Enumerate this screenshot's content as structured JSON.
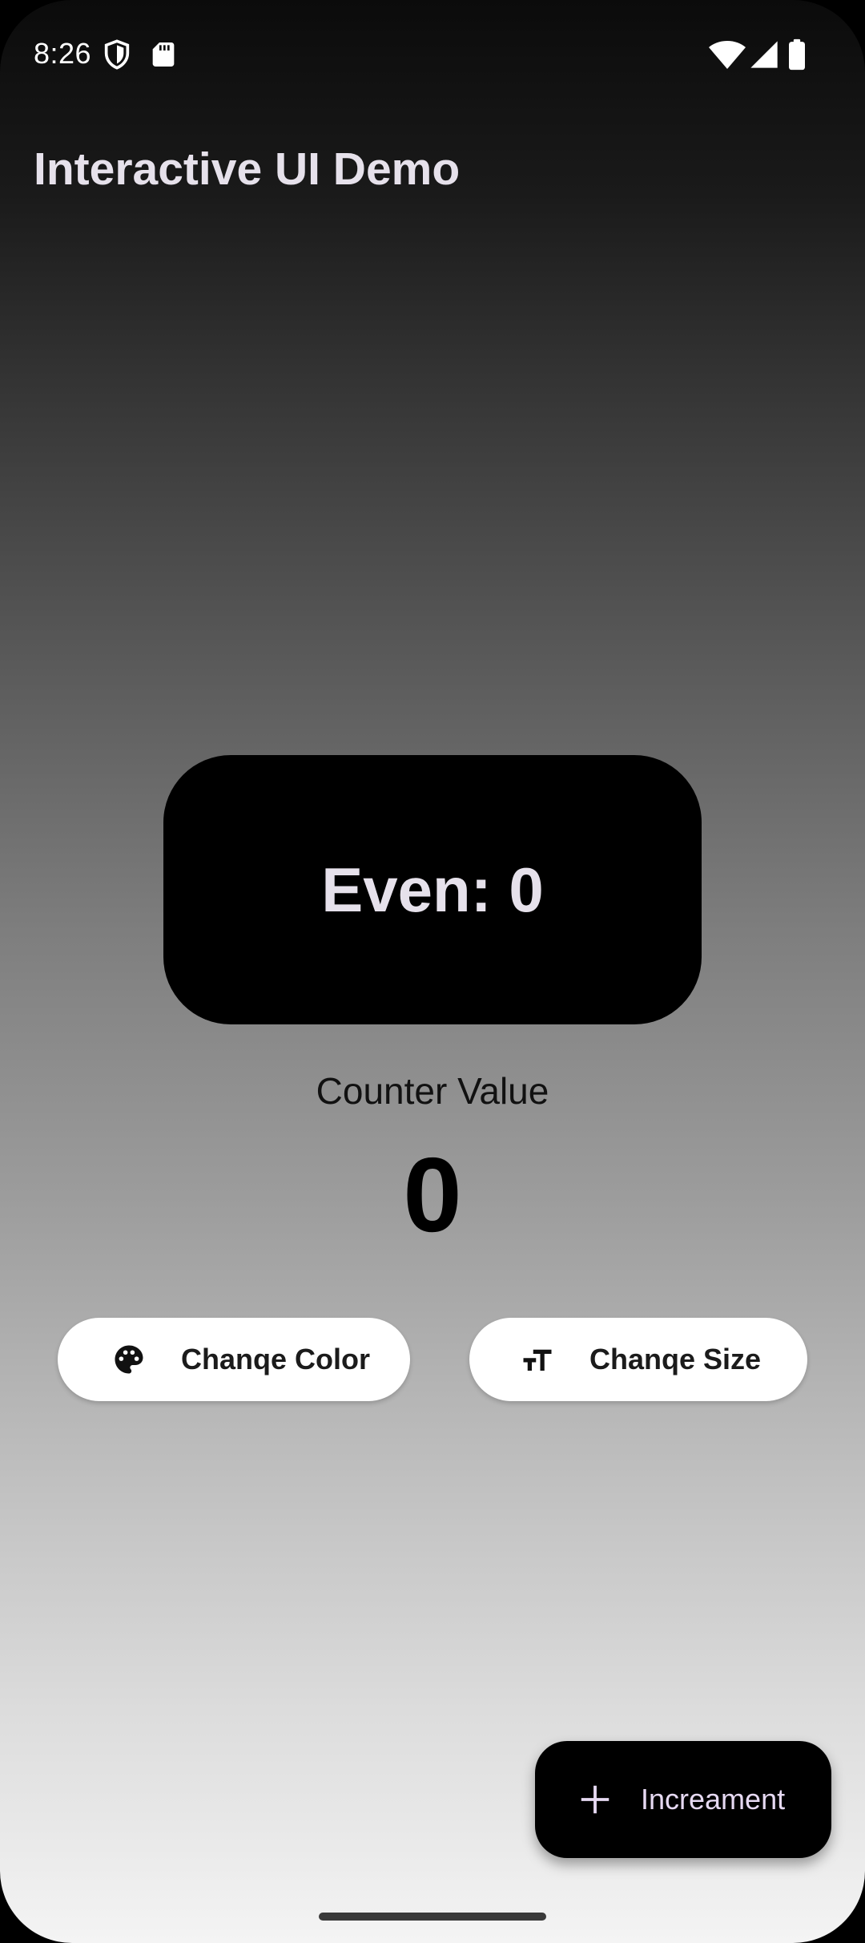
{
  "status_bar": {
    "time": "8:26",
    "icons": [
      "shield-icon",
      "sd-card-icon",
      "wifi-icon",
      "cellular-signal-icon",
      "battery-icon"
    ]
  },
  "app_bar": {
    "title": "Interactive UI Demo"
  },
  "parity_card": {
    "text": "Even: 0",
    "background": "#000000"
  },
  "counter": {
    "label": "Counter Value",
    "value": "0"
  },
  "actions": {
    "change_color": {
      "label": "Chanqe Color",
      "icon": "palette-icon"
    },
    "change_size": {
      "label": "Chanqe Size",
      "icon": "text-size-icon"
    }
  },
  "fab": {
    "label": "Increament",
    "icon": "plus-icon"
  },
  "colors": {
    "accent_text": "#e6e1eb",
    "fab_label": "#e6d9f2",
    "card": "#000000",
    "button_bg": "#ffffff"
  }
}
